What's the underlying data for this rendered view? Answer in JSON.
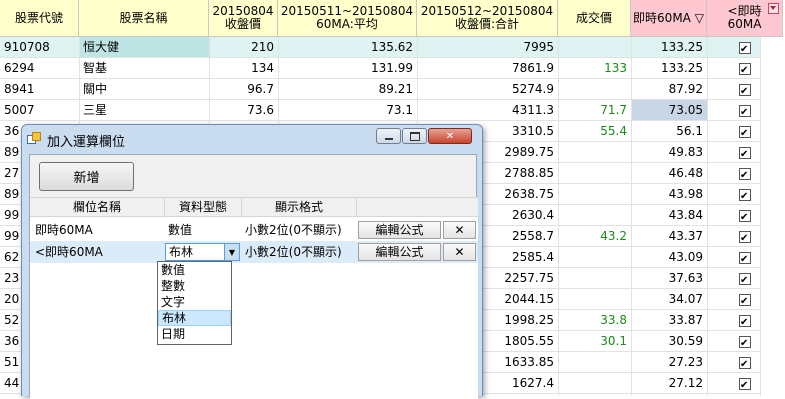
{
  "grid": {
    "headers": [
      {
        "line1": "股票代號",
        "line2": ""
      },
      {
        "line1": "股票名稱",
        "line2": ""
      },
      {
        "line1": "20150804",
        "line2": "收盤價"
      },
      {
        "line1": "20150511~20150804",
        "line2": "60MA:平均"
      },
      {
        "line1": "20150512~20150804",
        "line2": "收盤價:合計"
      },
      {
        "line1": "成交價",
        "line2": ""
      },
      {
        "line1": "即時60MA ▽",
        "line2": ""
      },
      {
        "line1": "<即時",
        "line2": "60MA"
      }
    ],
    "rows": [
      {
        "code": "910708",
        "name": "恒大健",
        "close": "210",
        "ma60": "135.62",
        "sum": "7995",
        "price": "",
        "rt60": "133.25",
        "flag": true
      },
      {
        "code": "6294",
        "name": "智基",
        "close": "134",
        "ma60": "131.99",
        "sum": "7861.9",
        "price": "133",
        "rt60": "133.25",
        "flag": true
      },
      {
        "code": "8941",
        "name": "關中",
        "close": "96.7",
        "ma60": "89.21",
        "sum": "5274.9",
        "price": "",
        "rt60": "87.92",
        "flag": true
      },
      {
        "code": "5007",
        "name": "三星",
        "close": "73.6",
        "ma60": "73.1",
        "sum": "4311.3",
        "price": "71.7",
        "rt60": "73.05",
        "flag": true
      },
      {
        "code": "36",
        "name": "",
        "close": "",
        "ma60": "",
        "sum": "3310.5",
        "price": "55.4",
        "rt60": "56.1",
        "flag": true
      },
      {
        "code": "89",
        "name": "",
        "close": "",
        "ma60": "",
        "sum": "2989.75",
        "price": "",
        "rt60": "49.83",
        "flag": true
      },
      {
        "code": "27",
        "name": "",
        "close": "",
        "ma60": "",
        "sum": "2788.85",
        "price": "",
        "rt60": "46.48",
        "flag": true
      },
      {
        "code": "89",
        "name": "",
        "close": "",
        "ma60": "",
        "sum": "2638.75",
        "price": "",
        "rt60": "43.98",
        "flag": true
      },
      {
        "code": "99",
        "name": "",
        "close": "",
        "ma60": "",
        "sum": "2630.4",
        "price": "",
        "rt60": "43.84",
        "flag": true
      },
      {
        "code": "99",
        "name": "",
        "close": "",
        "ma60": "",
        "sum": "2558.7",
        "price": "43.2",
        "rt60": "43.37",
        "flag": true
      },
      {
        "code": "62",
        "name": "",
        "close": "",
        "ma60": "",
        "sum": "2585.4",
        "price": "",
        "rt60": "43.09",
        "flag": true
      },
      {
        "code": "23",
        "name": "",
        "close": "",
        "ma60": "",
        "sum": "2257.75",
        "price": "",
        "rt60": "37.63",
        "flag": true
      },
      {
        "code": "20",
        "name": "",
        "close": "",
        "ma60": "",
        "sum": "2044.15",
        "price": "",
        "rt60": "34.07",
        "flag": true
      },
      {
        "code": "52",
        "name": "",
        "close": "",
        "ma60": "",
        "sum": "1998.25",
        "price": "33.8",
        "rt60": "33.87",
        "flag": true
      },
      {
        "code": "36",
        "name": "",
        "close": "",
        "ma60": "",
        "sum": "1805.55",
        "price": "30.1",
        "rt60": "30.59",
        "flag": true
      },
      {
        "code": "51",
        "name": "",
        "close": "",
        "ma60": "",
        "sum": "1633.85",
        "price": "",
        "rt60": "27.23",
        "flag": true
      },
      {
        "code": "44",
        "name": "",
        "close": "",
        "ma60": "",
        "sum": "1627.4",
        "price": "",
        "rt60": "27.12",
        "flag": true
      }
    ]
  },
  "dialog": {
    "title": "加入運算欄位",
    "add_button": "新增",
    "columns": [
      "欄位名稱",
      "資料型態",
      "顯示格式"
    ],
    "rows": [
      {
        "name": "即時60MA",
        "type": "數值",
        "format": "小數2位(0不顯示)",
        "edit": "編輯公式",
        "delete": "✕"
      },
      {
        "name": "<即時60MA",
        "type": "布林",
        "format": "小數2位(0不顯示)",
        "edit": "編輯公式",
        "delete": "✕"
      }
    ],
    "type_options": [
      "數值",
      "整數",
      "文字",
      "布林",
      "日期"
    ],
    "selected_option": "布林"
  }
}
